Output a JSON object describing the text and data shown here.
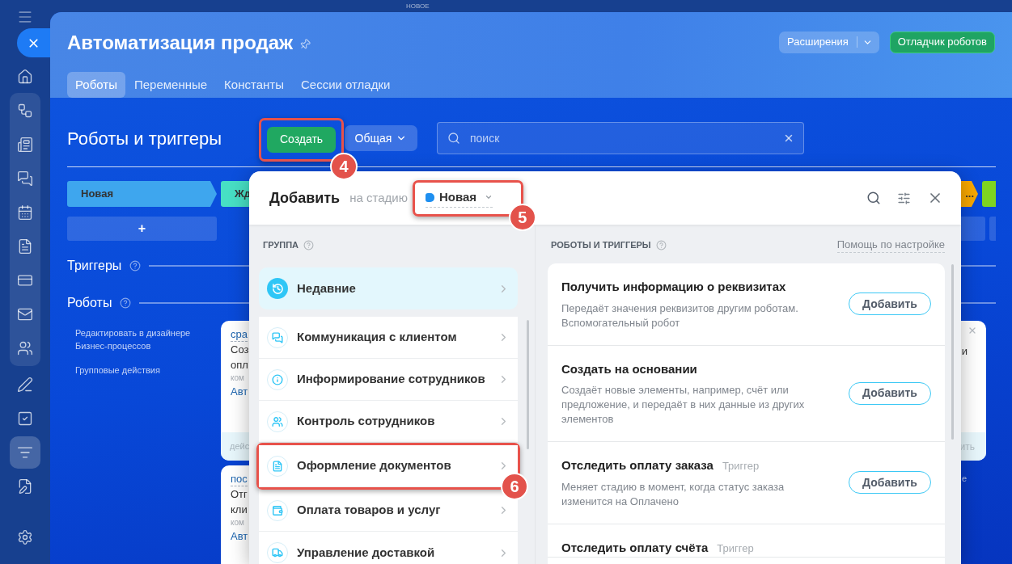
{
  "top_label": "НОВОЕ",
  "sidebar": {
    "top": [
      {
        "kind": "home",
        "selected": false
      }
    ],
    "group": [
      {
        "kind": "nodes",
        "selected": false
      },
      {
        "kind": "news",
        "selected": false
      },
      {
        "kind": "chat",
        "selected": false
      },
      {
        "kind": "calendar",
        "selected": false
      },
      {
        "kind": "document",
        "selected": false
      },
      {
        "kind": "card",
        "selected": false
      },
      {
        "kind": "mail",
        "selected": false
      },
      {
        "kind": "people",
        "selected": false
      }
    ],
    "bottom": [
      {
        "kind": "pencil",
        "selected": false
      },
      {
        "kind": "task",
        "selected": false
      },
      {
        "kind": "funnel",
        "selected": true
      },
      {
        "kind": "doc-edit",
        "selected": false
      }
    ],
    "footer": [
      {
        "kind": "settings",
        "selected": false
      }
    ]
  },
  "header": {
    "title": "Автоматизация продаж",
    "extensions_button": "Расширения",
    "debugger_button": "Отладчик роботов",
    "tabs": [
      {
        "label": "Роботы",
        "selected": true
      },
      {
        "label": "Переменные",
        "selected": false
      },
      {
        "label": "Константы",
        "selected": false
      },
      {
        "label": "Сессии отладки",
        "selected": false
      }
    ]
  },
  "toolbar": {
    "heading": "Роботы и триггеры",
    "create_button": "Создать",
    "create_callout": "4",
    "filter": "Общая",
    "search": {
      "placeholder": "поиск"
    }
  },
  "stages": [
    {
      "label": "Новая",
      "color": "#3ea6ee"
    },
    {
      "label": "Жд",
      "color": "#47dfc4"
    },
    {
      "label": "...",
      "color": "#f9a800"
    },
    {
      "color": "#7ed321"
    }
  ],
  "add_row": {
    "label": "+"
  },
  "sections": [
    "Триггеры",
    "Роботы"
  ],
  "robot_links": [
    "Редактировать в дизайнере Бизнес-процессов",
    "Групповые действия"
  ],
  "left_cards": [
    {
      "link": "сра",
      "lines": [
        "Соз",
        "опл"
      ],
      "meta": "ком",
      "status": "Авт",
      "footer": "дейс"
    },
    {
      "link": "пос",
      "lines": [
        "Отг",
        "кли"
      ],
      "meta": "ком",
      "status": "Авт"
    }
  ],
  "right_card": {
    "line": "и",
    "footer": "ить",
    "below": "е"
  },
  "popup": {
    "title": "Добавить",
    "stage_prefix": "на стадию",
    "stage": {
      "label": "Новая",
      "color": "#1e8ff0",
      "callout": "5"
    },
    "group_heading": "ГРУППА",
    "groups": [
      {
        "label": "Недавние",
        "kind": "recent",
        "selected": true
      },
      {
        "label": "Коммуникация с клиентом",
        "kind": "chat",
        "selected": false
      },
      {
        "label": "Информирование сотрудников",
        "kind": "info",
        "selected": false
      },
      {
        "label": "Контроль сотрудников",
        "kind": "people",
        "selected": false
      },
      {
        "label": "Оформление документов",
        "kind": "document",
        "selected": false,
        "callout": "6"
      },
      {
        "label": "Оплата товаров и услуг",
        "kind": "payment",
        "selected": false
      },
      {
        "label": "Управление доставкой",
        "kind": "delivery",
        "selected": false
      }
    ],
    "robots_heading": "РОБОТЫ И ТРИГГЕРЫ",
    "help_link": "Помощь по настройке",
    "robots": [
      {
        "title": "Получить информацию о реквизитах",
        "description": "Передаёт значения реквизитов другим роботам. Вспомогательный робот",
        "button": "Добавить"
      },
      {
        "title": "Создать на основании",
        "description": "Создаёт новые элементы, например, счёт или предложение, и передаёт в них данные из других элементов",
        "button": "Добавить"
      },
      {
        "title": "Отследить оплату заказа",
        "tag": "Триггер",
        "description": "Меняет стадию в момент, когда статус заказа изменится на Оплачено",
        "button": "Добавить"
      },
      {
        "title": "Отследить оплату счёта",
        "tag": "Триггер"
      }
    ]
  }
}
